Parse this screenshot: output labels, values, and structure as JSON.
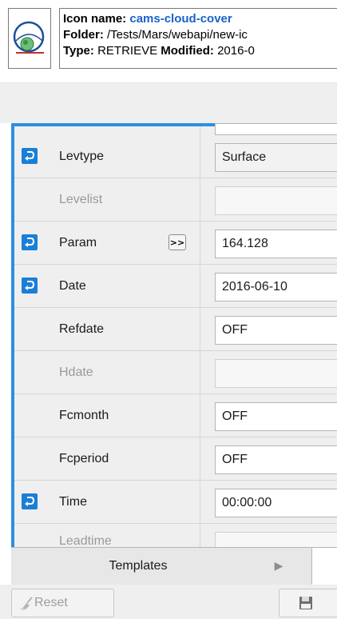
{
  "info": {
    "icon_name_label": "Icon name:",
    "icon_name_value": "cams-cloud-cover",
    "folder_label": "Folder:",
    "folder_value": "/Tests/Mars/webapi/new-ic",
    "type_label": "Type:",
    "type_value": "RETRIEVE",
    "modified_label": "Modified:",
    "modified_value": "2016-0",
    "icon": "mars-retrieve-icon"
  },
  "params": [
    {
      "label": "Levtype",
      "value": "Surface",
      "resettable": true,
      "enabled": true,
      "expand": false,
      "style": "plain"
    },
    {
      "label": "Levelist",
      "value": "",
      "resettable": false,
      "enabled": false,
      "expand": false,
      "style": "disabled"
    },
    {
      "label": "Param",
      "value": "164.128",
      "resettable": true,
      "enabled": true,
      "expand": true,
      "expand_label": ">>",
      "style": "input"
    },
    {
      "label": "Date",
      "value": "2016-06-10",
      "resettable": true,
      "enabled": true,
      "expand": false,
      "style": "input"
    },
    {
      "label": "Refdate",
      "value": "OFF",
      "resettable": false,
      "enabled": true,
      "expand": false,
      "style": "input"
    },
    {
      "label": "Hdate",
      "value": "",
      "resettable": false,
      "enabled": false,
      "expand": false,
      "style": "disabled"
    },
    {
      "label": "Fcmonth",
      "value": "OFF",
      "resettable": false,
      "enabled": true,
      "expand": false,
      "style": "input"
    },
    {
      "label": "Fcperiod",
      "value": "OFF",
      "resettable": false,
      "enabled": true,
      "expand": false,
      "style": "input"
    },
    {
      "label": "Time",
      "value": "00:00:00",
      "resettable": true,
      "enabled": true,
      "expand": false,
      "style": "input"
    },
    {
      "label": "Leadtime",
      "value": "",
      "resettable": false,
      "enabled": false,
      "expand": false,
      "style": "disabled",
      "partial": true
    }
  ],
  "templates": {
    "label": "Templates",
    "arrow": "▶"
  },
  "buttons": {
    "reset_label": "Reset"
  },
  "colors": {
    "accent": "#2f8ee3",
    "reset_icon": "#1a7fd6",
    "link_blue": "#1a62c8"
  }
}
